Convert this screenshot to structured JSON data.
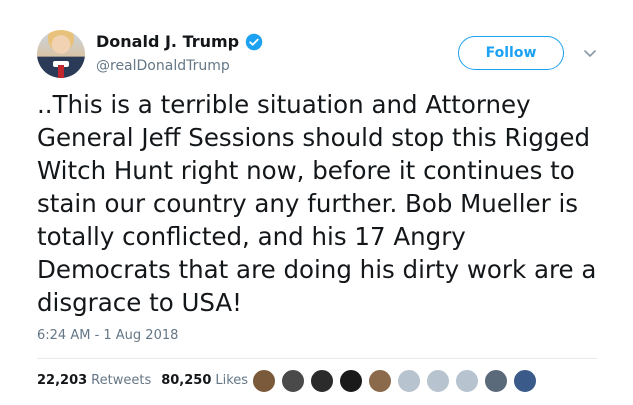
{
  "author": {
    "display_name": "Donald J. Trump",
    "handle": "@realDonaldTrump",
    "verified": true,
    "avatar_icon": "avatar-portrait"
  },
  "actions": {
    "follow_label": "Follow",
    "more_icon": "chevron-down-icon"
  },
  "tweet": {
    "text_lines": [
      "..This is a terrible situation and Attorney",
      "General Jeff Sessions should stop this Rigged",
      "Witch Hunt right now, before it continues to",
      "stain our country any further. Bob Mueller is",
      "totally conflicted, and his 17 Angry",
      "Democrats that are doing his dirty work are a",
      "disgrace to USA!"
    ],
    "timestamp": "6:24 AM - 1 Aug 2018"
  },
  "stats": {
    "retweets_count": "22,203",
    "retweets_label": "Retweets",
    "likes_count": "80,250",
    "likes_label": "Likes"
  },
  "likers": {
    "avatar_colors": [
      "#7a5a3a",
      "#4a4a4a",
      "#2b2b2b",
      "#1a1a1a",
      "#8a6a4a",
      "#b7c3cf",
      "#b7c3cf",
      "#b7c3cf",
      "#5a6a7a",
      "#3a5a8a"
    ]
  },
  "colors": {
    "accent": "#1da1f2",
    "text": "#14171a",
    "muted": "#657786"
  }
}
